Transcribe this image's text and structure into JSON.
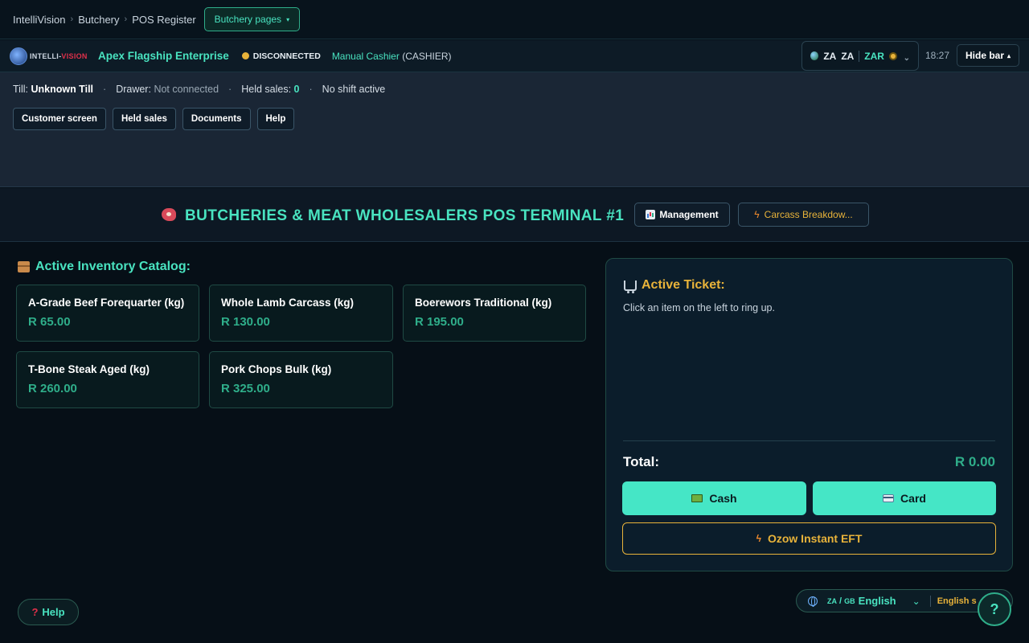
{
  "breadcrumb": {
    "items": [
      "IntelliVision",
      "Butchery",
      "POS Register"
    ],
    "separator": "›"
  },
  "pages_button": {
    "label": "Butchery pages",
    "caret": "▾"
  },
  "infobar": {
    "company": "Apex Flagship Enterprise",
    "connection": "DISCONNECTED",
    "cashier_name": "Manual Cashier",
    "cashier_role": "(CASHIER)",
    "locale": {
      "region1": "ZA",
      "region2": "ZA",
      "currency": "ZAR",
      "chevron": "⌄"
    },
    "clock": "18:27",
    "hide_bar": {
      "label": "Hide bar",
      "caret": "▴"
    }
  },
  "status": {
    "till_label": "Till:",
    "till_value": "Unknown Till",
    "drawer_label": "Drawer:",
    "drawer_value": "Not connected",
    "held_label": "Held sales:",
    "held_value": "0",
    "shift": "No shift active",
    "separator": "·"
  },
  "actions": [
    "Customer screen",
    "Held sales",
    "Documents",
    "Help"
  ],
  "terminal": {
    "title": "BUTCHERIES & MEAT WHOLESALERS POS TERMINAL #1",
    "management_label": "Management",
    "carcass_label": "Carcass Breakdow...",
    "bolt": "ϟ"
  },
  "catalog": {
    "heading": "Active Inventory Catalog:",
    "items": [
      {
        "name": "A-Grade Beef Forequarter (kg)",
        "price": "R 65.00"
      },
      {
        "name": "Whole Lamb Carcass (kg)",
        "price": "R 130.00"
      },
      {
        "name": "Boerewors Traditional (kg)",
        "price": "R 195.00"
      },
      {
        "name": "T-Bone Steak Aged (kg)",
        "price": "R 260.00"
      },
      {
        "name": "Pork Chops Bulk (kg)",
        "price": "R 325.00"
      }
    ]
  },
  "ticket": {
    "heading": "Active Ticket:",
    "hint": "Click an item on the left to ring up.",
    "total_label": "Total:",
    "total_value": "R 0.00",
    "cash_label": "Cash",
    "card_label": "Card",
    "ozow_label": "Ozow Instant EFT"
  },
  "footer": {
    "help_label": "Help",
    "help_glyph": "?",
    "lang_code_from": "ZA",
    "lang_code_sep": " / ",
    "lang_code_to": "GB",
    "lang_name": "English",
    "lang_chevron": "⌄",
    "lang_hint": "English s",
    "fab_glyph": "?"
  },
  "colors": {
    "accent": "#49e3c0",
    "price": "#2fae8a",
    "warning": "#e8b33a",
    "background": "#060f17"
  }
}
